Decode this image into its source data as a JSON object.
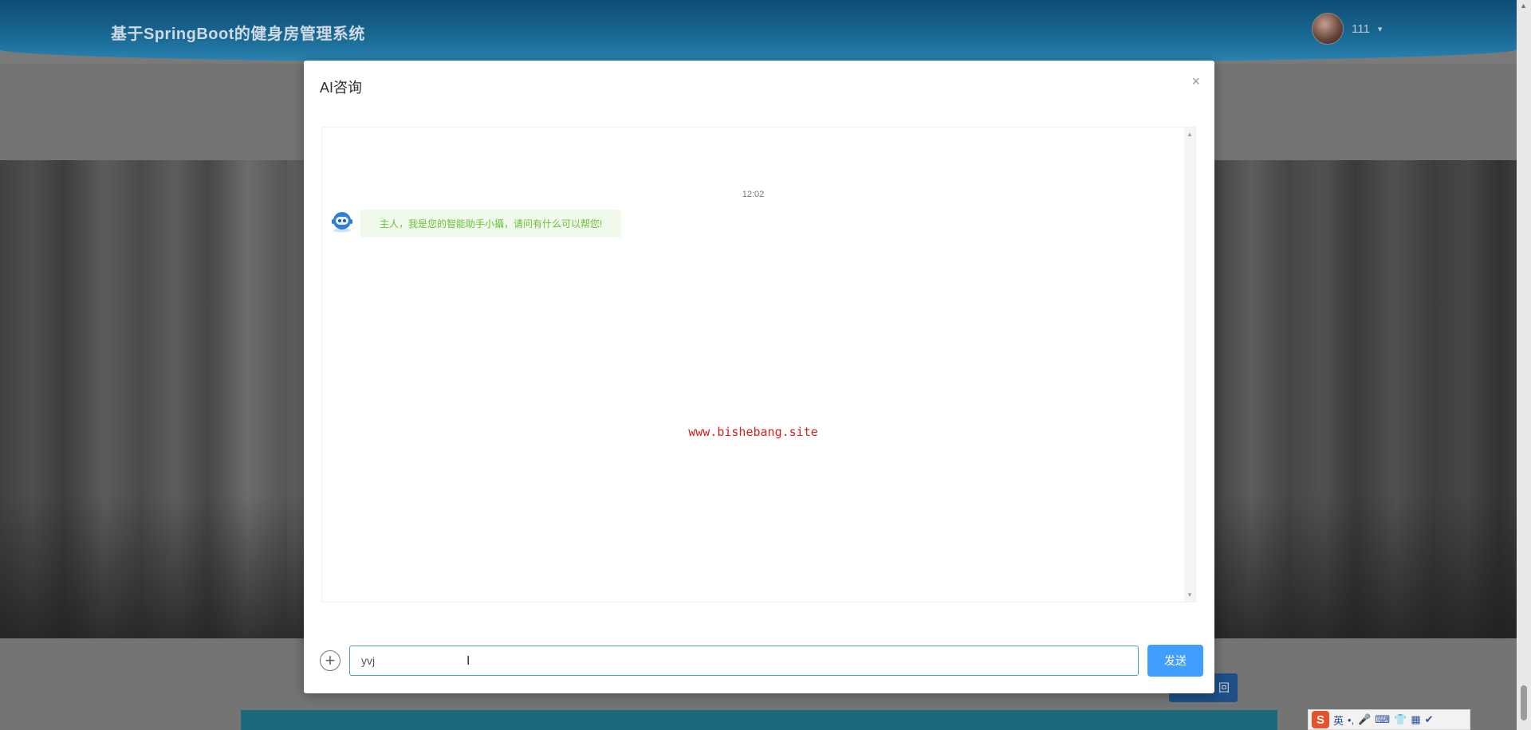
{
  "site": {
    "title": "基于SpringBoot的健身房管理系统"
  },
  "user": {
    "name": "111",
    "caret": "▾"
  },
  "background": {
    "button_label": "回",
    "footer_text": ""
  },
  "modal": {
    "title": "AI咨询",
    "close_symbol": "×",
    "timestamp": "12:02",
    "bot_message": "主人，我是您的智能助手小攝，请问有什么可以帮您!",
    "watermark": "www.bishebang.site",
    "input_value": "yvj",
    "send_label": "发送",
    "plus_symbol": "+"
  },
  "ime": {
    "logo": "S",
    "lang": "英",
    "items": [
      "•,",
      "🎤",
      "⌨",
      "👕",
      "▦",
      "✔"
    ]
  },
  "colors": {
    "header_blue": "#1a6a95",
    "send_blue": "#409eff",
    "bubble_bg": "#f0f9eb",
    "bubble_text": "#67c23a",
    "watermark_red": "#d42020"
  }
}
